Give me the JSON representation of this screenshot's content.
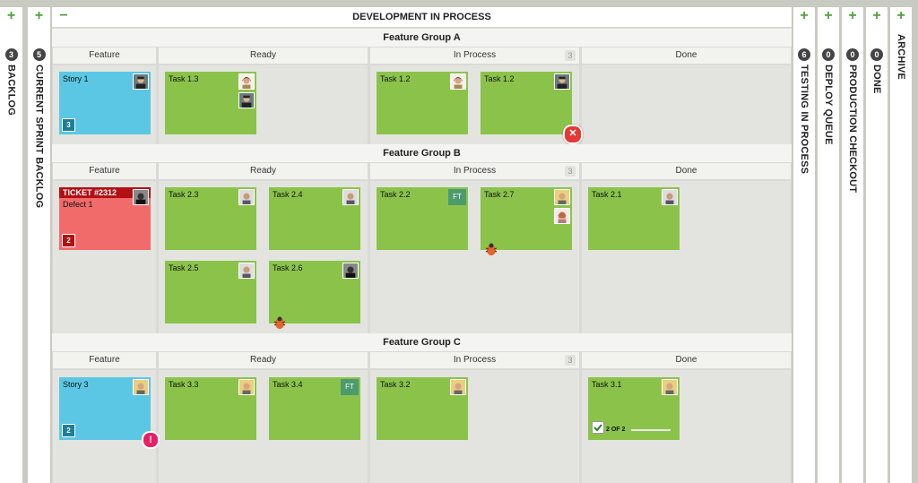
{
  "left_columns": [
    {
      "plus": "+",
      "count": "3",
      "label": "BACKLOG"
    },
    {
      "plus": "+",
      "count": "5",
      "label": "CURRENT SPRINT BACKLOG"
    }
  ],
  "right_columns": [
    {
      "plus": "+",
      "count": "6",
      "label": "TESTING IN PROCESS"
    },
    {
      "plus": "+",
      "count": "0",
      "label": "DEPLOY QUEUE"
    },
    {
      "plus": "+",
      "count": "0",
      "label": "PRODUCTION CHECKOUT"
    },
    {
      "plus": "+",
      "count": "0",
      "label": "DONE"
    },
    {
      "plus": "+",
      "label": "ARCHIVE"
    }
  ],
  "main": {
    "collapse": "−",
    "title": "DEVELOPMENT IN PROCESS",
    "lanes": {
      "feature": "Feature",
      "ready": "Ready",
      "in_process": "In Process",
      "in_process_limit": "3",
      "done": "Done"
    },
    "groups": [
      {
        "title": "Feature Group A",
        "cards": {
          "story1": {
            "title": "Story 1",
            "badge": "3"
          },
          "task13": {
            "title": "Task 1.3"
          },
          "task12a": {
            "title": "Task 1.2"
          },
          "task12b": {
            "title": "Task 1.2"
          }
        }
      },
      {
        "title": "Feature Group B",
        "cards": {
          "defect1": {
            "ticket": "TICKET #2312",
            "title": "Defect 1",
            "badge": "2"
          },
          "task23": {
            "title": "Task 2.3"
          },
          "task24": {
            "title": "Task 2.4"
          },
          "task25": {
            "title": "Task 2.5"
          },
          "task26": {
            "title": "Task 2.6"
          },
          "task22": {
            "title": "Task 2.2",
            "tag": "FT"
          },
          "task27": {
            "title": "Task 2.7"
          },
          "task21": {
            "title": "Task 2.1"
          }
        }
      },
      {
        "title": "Feature Group C",
        "cards": {
          "story3": {
            "title": "Story 3",
            "badge": "2"
          },
          "task33": {
            "title": "Task 3.3"
          },
          "task34": {
            "title": "Task 3.4",
            "tag": "FT"
          },
          "task32": {
            "title": "Task 3.2"
          },
          "task31": {
            "title": "Task 3.1",
            "progress": "2 OF 2",
            "progress_fraction": 1.0
          }
        }
      }
    ]
  },
  "colors": {
    "task": "#8bc34a",
    "story": "#5bc7e4",
    "defect": "#f26b6b",
    "plus": "#4fa33b"
  }
}
